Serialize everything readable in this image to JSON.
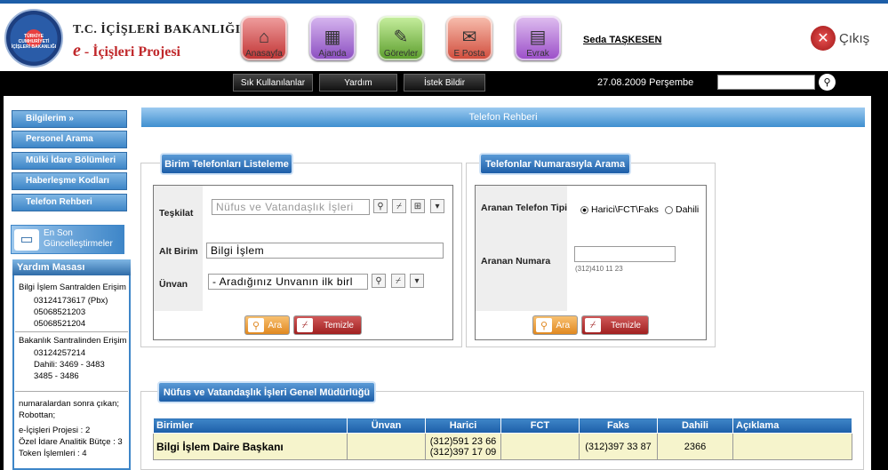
{
  "header": {
    "seal_text": "TÜRKİYE CUMHURİYETİ İÇİŞLERİ BAKANLIĞI",
    "ministry": "T.C. İÇİŞLERİ BAKANLIĞI",
    "project_prefix": "e",
    "project_name": "- İçişleri Projesi",
    "nav": [
      {
        "label": "Anasayfa",
        "icon": "home-icon"
      },
      {
        "label": "Ajanda",
        "icon": "calendar-icon"
      },
      {
        "label": "Görevler",
        "icon": "tasks-icon"
      },
      {
        "label": "E Posta",
        "icon": "mail-icon"
      },
      {
        "label": "Evrak",
        "icon": "document-icon"
      }
    ],
    "username": "Seda TAŞKESEN",
    "logout": "Çıkış"
  },
  "topbar": {
    "frequent": "Sık Kullanılanlar",
    "help": "Yardım",
    "request": "İstek Bildir",
    "date": "27.08.2009 Perşembe",
    "search_value": ""
  },
  "sidebar": {
    "items": [
      {
        "label": "Bilgilerim  »"
      },
      {
        "label": "Personel Arama"
      },
      {
        "label": "Mülki İdare Bölümleri"
      },
      {
        "label": "Haberleşme Kodları"
      },
      {
        "label": "Telefon Rehberi"
      }
    ],
    "updates_line1": "En Son",
    "updates_line2": "Güncelleştirmeler",
    "helpdesk": {
      "title": "Yardım Masası",
      "central_title": "Bilgi İşlem Santralden Erişim",
      "central_numbers": [
        "03124173617 (Pbx)",
        "05068521203",
        "05068521204"
      ],
      "ministry_title": "Bakanlık Santralinden Erişim",
      "ministry_lines": [
        "03124257214",
        "Dahili: 3469 - 3483",
        "3485 - 3486"
      ],
      "robot_title": "numaralardan sonra çıkan; Robottan;",
      "robot_lines": [
        "e-İçişleri Projesi : 2",
        "Özel İdare Analitik Bütçe : 3",
        "Token İşlemleri : 4"
      ]
    }
  },
  "main": {
    "title": "Telefon Rehberi",
    "unit_panel": {
      "tab": "Birim Telefonları Listeleme",
      "org_label": "Teşkilat",
      "org_value": "Nüfus ve Vatandaşlık İşleri",
      "subunit_label": "Alt Birim",
      "subunit_value": "Bilgi İşlem",
      "title_label": "Ünvan",
      "title_value": "- Aradığınız Unvanın ilk birl",
      "search_btn": "Ara",
      "clear_btn": "Temizle"
    },
    "number_panel": {
      "tab": "Telefonlar Numarasıyla Arama",
      "type_label": "Aranan Telefon Tipi",
      "type_opt1": "Harici\\FCT\\Faks",
      "type_opt2": "Dahili",
      "number_label": "Aranan Numara",
      "number_value": "",
      "number_hint": "(312)410 11 23",
      "search_btn": "Ara",
      "clear_btn": "Temizle"
    },
    "results": {
      "tab": "Nüfus ve Vatandaşlık İşleri Genel Müdürlüğü",
      "columns": [
        "Birimler",
        "Ünvan",
        "Harici",
        "FCT",
        "Faks",
        "Dahili",
        "Açıklama"
      ],
      "rows": [
        {
          "unit": "Bilgi İşlem Daire Başkanı",
          "title": "",
          "external1": "(312)591 23 66",
          "external2": "(312)397 17 09",
          "fct": "",
          "fax": "(312)397 33 87",
          "internal": "2366",
          "note": ""
        }
      ]
    }
  },
  "colors": {
    "accent": "#1d5ea8",
    "brand_red": "#c0282b",
    "row_bg": "#f6f4cc"
  }
}
